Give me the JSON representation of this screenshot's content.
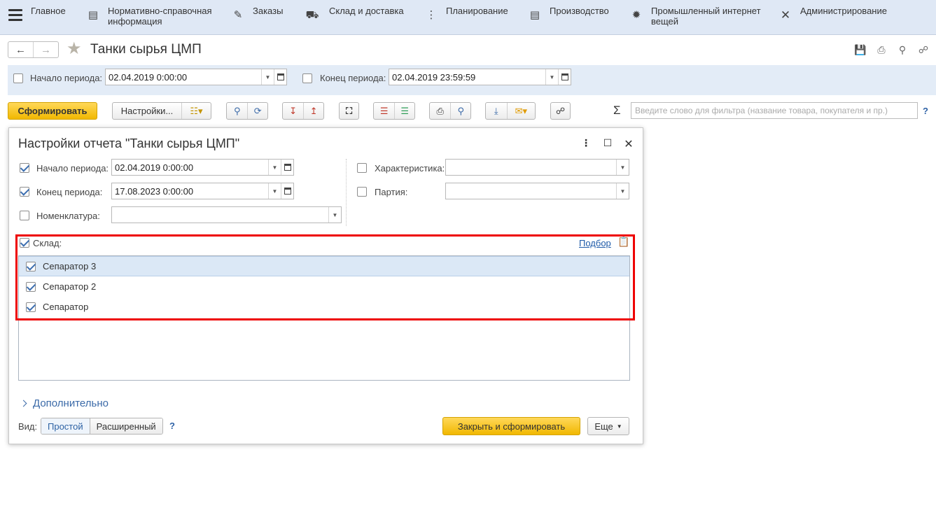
{
  "sections": [
    {
      "label": "Главное",
      "icon": "menu-icon"
    },
    {
      "label": "Нормативно-справочная информация",
      "icon": "document-icon"
    },
    {
      "label": "Заказы",
      "icon": "orders-icon"
    },
    {
      "label": "Склад и доставка",
      "icon": "truck-icon"
    },
    {
      "label": "Планирование",
      "icon": "planning-icon"
    },
    {
      "label": "Производство",
      "icon": "factory-icon"
    },
    {
      "label": "Промышленный интернет вещей",
      "icon": "iot-icon"
    },
    {
      "label": "Администрирование",
      "icon": "tools-icon"
    }
  ],
  "page": {
    "title": "Танки сырья ЦМП"
  },
  "period": {
    "start_label": "Начало периода:",
    "start_value": "02.04.2019  0:00:00",
    "end_label": "Конец периода:",
    "end_value": "02.04.2019 23:59:59"
  },
  "toolbar": {
    "generate_label": "Сформировать",
    "settings_label": "Настройки...",
    "filter_placeholder": "Введите слово для фильтра (название товара, покупателя и пр.)",
    "help": "?",
    "sigma": "Σ"
  },
  "dialog": {
    "title": "Настройки отчета \"Танки сырья ЦМП\"",
    "start_label": "Начало периода:",
    "start_value": "02.04.2019  0:00:00",
    "end_label": "Конец периода:",
    "end_value": "17.08.2023  0:00:00",
    "nomenclature_label": "Номенклатура:",
    "characteristic_label": "Характеристика:",
    "batch_label": "Партия:",
    "warehouse_label": "Склад:",
    "pick_link": "Подбор",
    "warehouses": [
      "Сепаратор 3",
      "Сепаратор 2",
      "Сепаратор"
    ],
    "more_label": "Дополнительно",
    "view_label": "Вид:",
    "view_simple": "Простой",
    "view_extended": "Расширенный",
    "help": "?",
    "close_generate_label": "Закрыть и сформировать",
    "more_button_label": "Еще"
  }
}
